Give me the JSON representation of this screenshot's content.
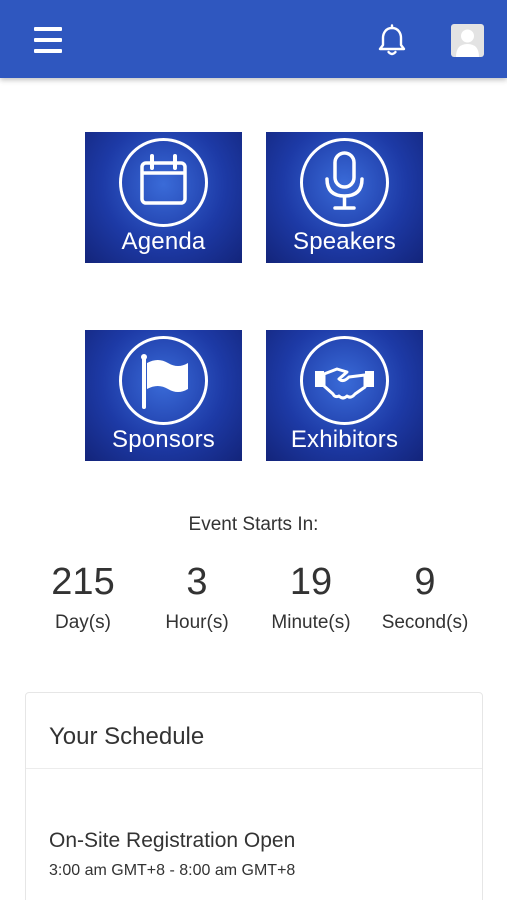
{
  "header": {
    "background_color": "#2f57bf",
    "menu_icon": "hamburger-menu-icon",
    "notification_icon": "bell-icon",
    "profile_icon": "user-avatar-icon"
  },
  "tiles": [
    {
      "label": "Agenda",
      "icon": "calendar-icon"
    },
    {
      "label": "Speakers",
      "icon": "microphone-icon"
    },
    {
      "label": "Sponsors",
      "icon": "flag-icon"
    },
    {
      "label": "Exhibitors",
      "icon": "handshake-icon"
    }
  ],
  "countdown": {
    "title": "Event Starts In:",
    "units": [
      {
        "value": "215",
        "label": "Day(s)"
      },
      {
        "value": "3",
        "label": "Hour(s)"
      },
      {
        "value": "19",
        "label": "Minute(s)"
      },
      {
        "value": "9",
        "label": "Second(s)"
      }
    ]
  },
  "schedule": {
    "title": "Your Schedule",
    "items": [
      {
        "title": "On-Site Registration Open",
        "time": "3:00 am GMT+8 - 8:00 am GMT+8"
      }
    ]
  }
}
